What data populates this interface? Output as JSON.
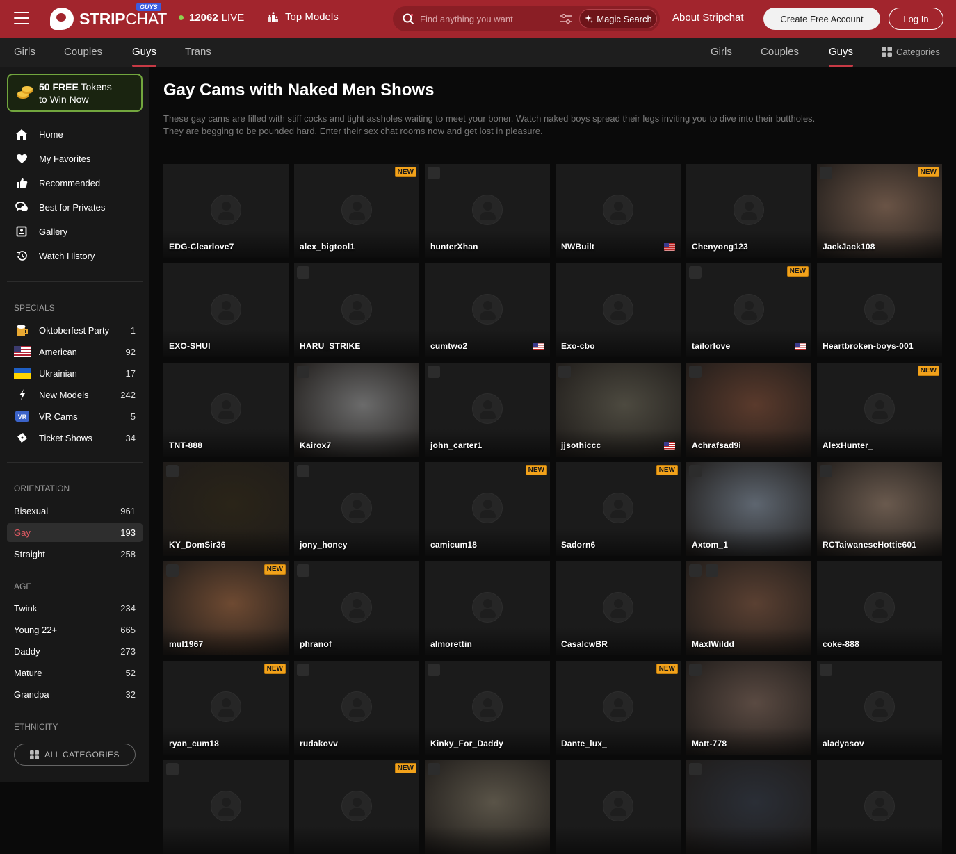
{
  "header": {
    "logo_bold": "STRIP",
    "logo_light": "CHAT",
    "logo_badge": "GUYS",
    "live_count": "12062",
    "live_label": "LIVE",
    "top_models": "Top Models",
    "search_placeholder": "Find anything you want",
    "magic_search": "Magic Search",
    "about": "About Stripchat",
    "create_account": "Create Free Account",
    "login": "Log In"
  },
  "subnav": {
    "left_tabs": [
      "Girls",
      "Couples",
      "Guys",
      "Trans"
    ],
    "right_tabs": [
      "Girls",
      "Couples",
      "Guys"
    ],
    "active": "Guys",
    "categories": "Categories"
  },
  "sidebar": {
    "promo_bold": "50 FREE",
    "promo_rest": "Tokens",
    "promo_line2": "to Win Now",
    "menu": [
      {
        "label": "Home",
        "icon": "home-icon"
      },
      {
        "label": "My Favorites",
        "icon": "heart-icon"
      },
      {
        "label": "Recommended",
        "icon": "thumbs-up-icon"
      },
      {
        "label": "Best for Privates",
        "icon": "chat-bubbles-icon"
      },
      {
        "label": "Gallery",
        "icon": "gallery-icon"
      },
      {
        "label": "Watch History",
        "icon": "history-icon"
      }
    ],
    "specials_heading": "SPECIALS",
    "specials": [
      {
        "label": "Oktoberfest Party",
        "count": "1",
        "icon": "beer-icon"
      },
      {
        "label": "American",
        "count": "92",
        "icon": "us-flag-icon"
      },
      {
        "label": "Ukrainian",
        "count": "17",
        "icon": "ua-flag-icon"
      },
      {
        "label": "New Models",
        "count": "242",
        "icon": "lightning-icon"
      },
      {
        "label": "VR Cams",
        "count": "5",
        "icon": "vr-icon"
      },
      {
        "label": "Ticket Shows",
        "count": "34",
        "icon": "ticket-icon"
      }
    ],
    "orientation_heading": "ORIENTATION",
    "orientation": [
      {
        "label": "Bisexual",
        "count": "961"
      },
      {
        "label": "Gay",
        "count": "193",
        "active": true
      },
      {
        "label": "Straight",
        "count": "258"
      }
    ],
    "age_heading": "AGE",
    "age": [
      {
        "label": "Twink",
        "count": "234"
      },
      {
        "label": "Young 22+",
        "count": "665"
      },
      {
        "label": "Daddy",
        "count": "273"
      },
      {
        "label": "Mature",
        "count": "52"
      },
      {
        "label": "Grandpa",
        "count": "32"
      }
    ],
    "ethnicity_heading": "ETHNICITY",
    "all_categories": "ALL CATEGORIES"
  },
  "main": {
    "title": "Gay Cams with Naked Men Shows",
    "description_line1": "These gay cams are filled with stiff cocks and tight assholes waiting to meet your boner. Watch naked boys spread their legs inviting you to dive into their buttholes.",
    "description_line2": "They are begging to be pounded hard. Enter their sex chat rooms now and get lost in pleasure.",
    "new_badge": "NEW",
    "models": [
      {
        "name": "EDG-Clearlove7"
      },
      {
        "name": "alex_bigtool1",
        "new": true
      },
      {
        "name": "hunterXhan",
        "check": true
      },
      {
        "name": "NWBuilt",
        "flag": "us"
      },
      {
        "name": "Chenyong123"
      },
      {
        "name": "JackJack108",
        "new": true,
        "check": true,
        "photo": "#6a5446"
      },
      {
        "name": "EXO-SHUI"
      },
      {
        "name": "HARU_STRIKE",
        "check": true
      },
      {
        "name": "cumtwo2",
        "flag": "us"
      },
      {
        "name": "Exo-cbo"
      },
      {
        "name": "tailorlove",
        "new": true,
        "check": true,
        "flag": "us"
      },
      {
        "name": "Heartbroken-boys-001"
      },
      {
        "name": "TNT-888"
      },
      {
        "name": "Kairox7",
        "check": true,
        "photo": "#6b6b6b"
      },
      {
        "name": "john_carter1",
        "check": true
      },
      {
        "name": "jjsothiccc",
        "check": true,
        "flag": "us",
        "photo": "#4d4a40"
      },
      {
        "name": "Achrafsad9i",
        "check": true,
        "photo": "#5a3a2c"
      },
      {
        "name": "AlexHunter_",
        "new": true
      },
      {
        "name": "KY_DomSir36",
        "check": true,
        "photo": "#2a2418"
      },
      {
        "name": "jony_honey",
        "check": true
      },
      {
        "name": "camicum18",
        "new": true
      },
      {
        "name": "Sadorn6",
        "new": true
      },
      {
        "name": "Axtom_1",
        "check": true,
        "photo": "#5e6670"
      },
      {
        "name": "RCTaiwaneseHottie601",
        "check": true,
        "photo": "#6a5a4e"
      },
      {
        "name": "mul1967",
        "new": true,
        "check": true,
        "photo": "#6e4a32"
      },
      {
        "name": "phranof_",
        "check": true
      },
      {
        "name": "almorettin"
      },
      {
        "name": "CasalcwBR"
      },
      {
        "name": "MaxlWildd",
        "check": true,
        "check2": true,
        "photo": "#5a4032"
      },
      {
        "name": "coke-888"
      },
      {
        "name": "ryan_cum18",
        "new": true
      },
      {
        "name": "rudakovv",
        "check": true
      },
      {
        "name": "Kinky_For_Daddy",
        "check": true
      },
      {
        "name": "Dante_lux_",
        "new": true
      },
      {
        "name": "Matt-778",
        "check": true,
        "photo": "#5a4a42"
      },
      {
        "name": "aladyasov",
        "check": true
      },
      {
        "name": "",
        "check": true
      },
      {
        "name": "",
        "new": true
      },
      {
        "name": "",
        "check": true,
        "photo": "#5a5448"
      },
      {
        "name": ""
      },
      {
        "name": "",
        "check": true,
        "photo": "#2a2e36"
      },
      {
        "name": ""
      }
    ]
  }
}
